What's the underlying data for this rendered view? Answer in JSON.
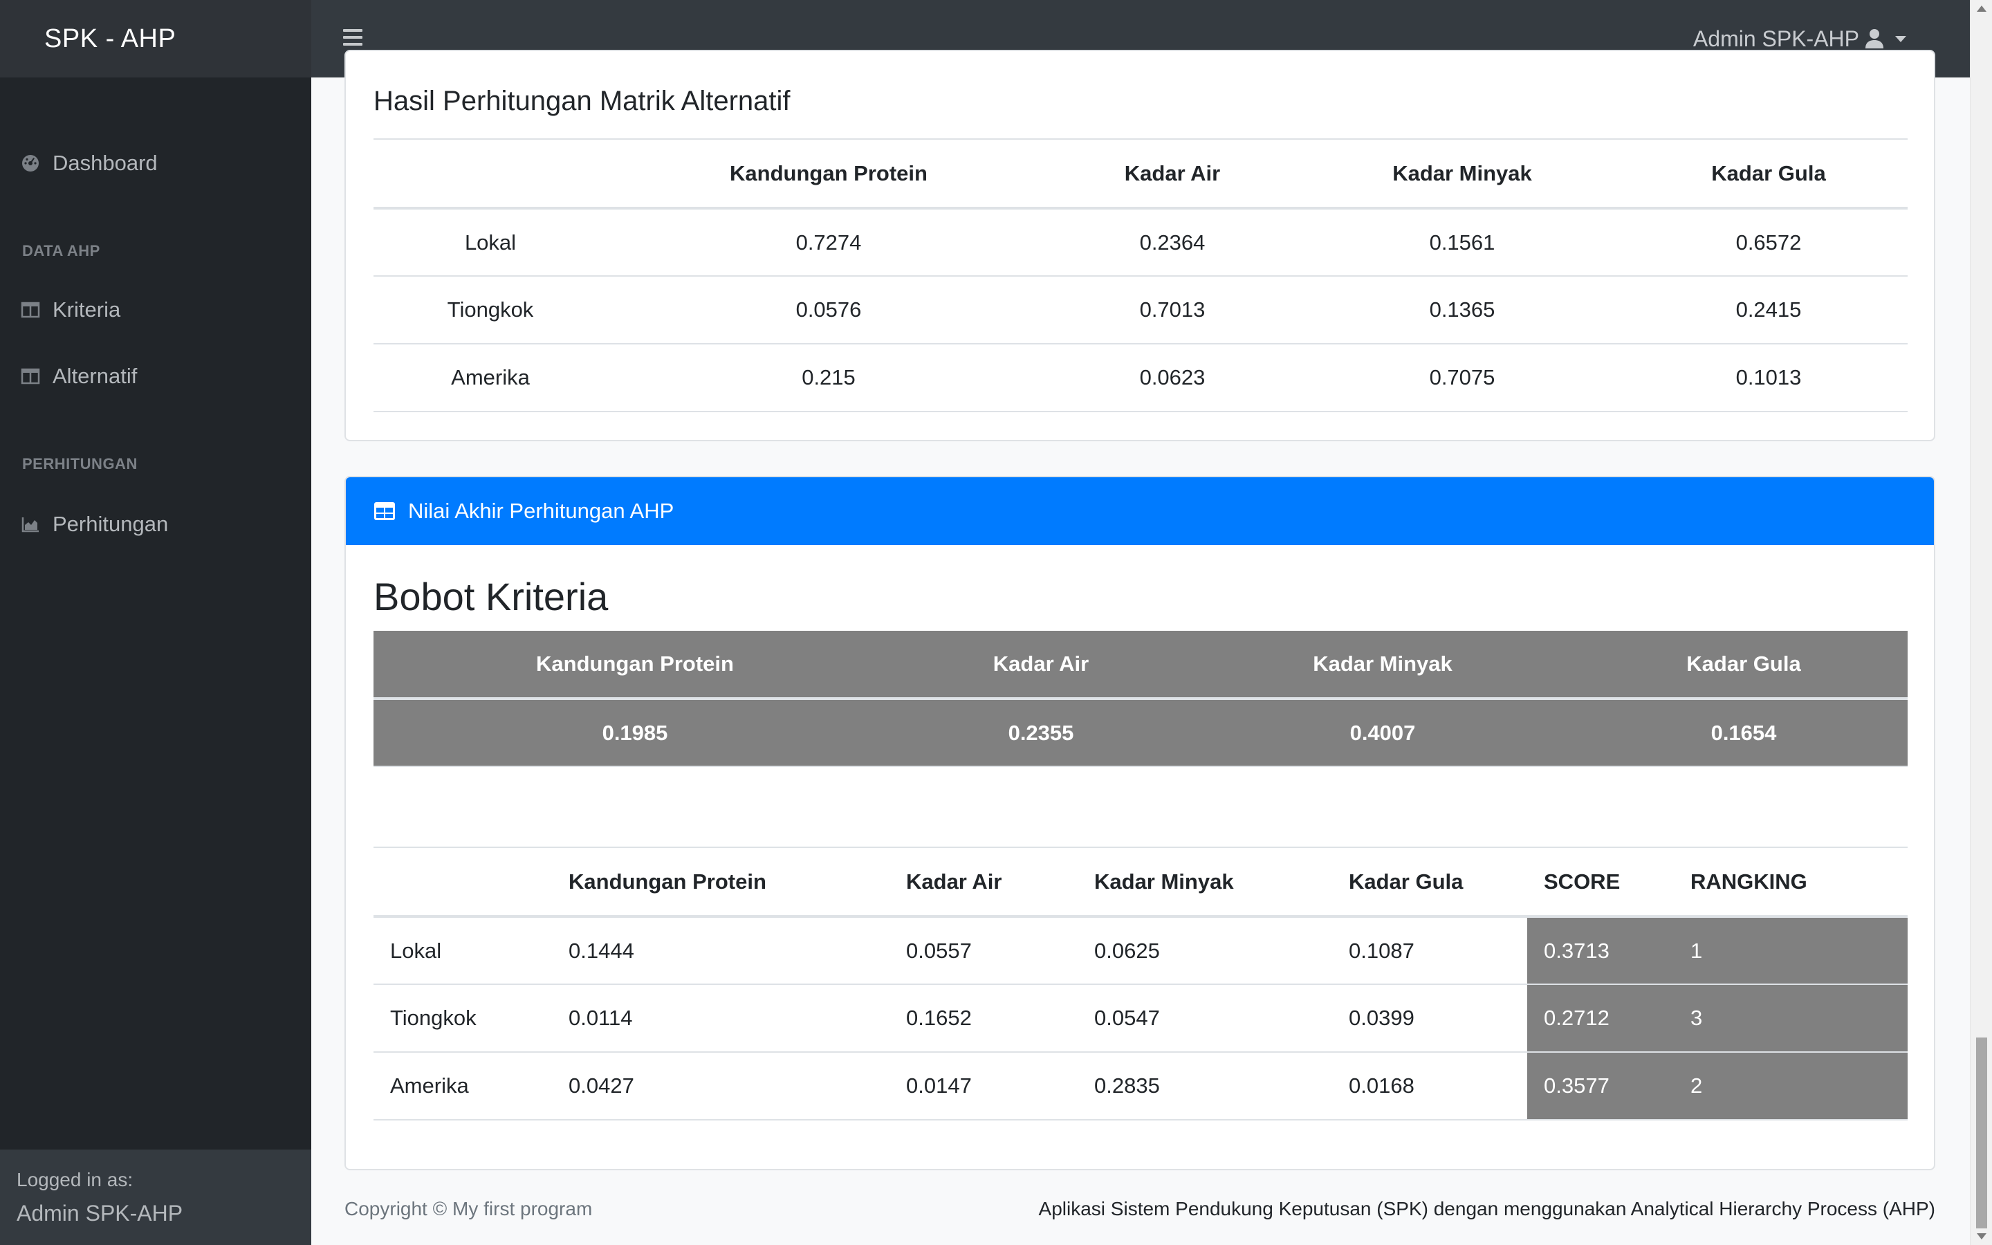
{
  "app": {
    "brand": "SPK - AHP"
  },
  "header": {
    "user_label": "Admin SPK-AHP"
  },
  "sidebar": {
    "dashboard": "Dashboard",
    "heading_data": "DATA AHP",
    "kriteria": "Kriteria",
    "alternatif": "Alternatif",
    "heading_perhitungan": "PERHITUNGAN",
    "perhitungan": "Perhitungan",
    "footer_small": "Logged in as:",
    "footer_name": "Admin SPK-AHP"
  },
  "matrix_card": {
    "title": "Hasil Perhitungan Matrik Alternatif",
    "headers": [
      "",
      "Kandungan Protein",
      "Kadar Air",
      "Kadar Minyak",
      "Kadar Gula"
    ],
    "rows": [
      [
        "Lokal",
        "0.7274",
        "0.2364",
        "0.1561",
        "0.6572"
      ],
      [
        "Tiongkok",
        "0.0576",
        "0.7013",
        "0.1365",
        "0.2415"
      ],
      [
        "Amerika",
        "0.215",
        "0.0623",
        "0.7075",
        "0.1013"
      ]
    ]
  },
  "result_card": {
    "header": "Nilai Akhir Perhitungan AHP",
    "bobot_title": "Bobot Kriteria",
    "bobot_headers": [
      "Kandungan Protein",
      "Kadar Air",
      "Kadar Minyak",
      "Kadar Gula"
    ],
    "bobot_values": [
      "0.1985",
      "0.2355",
      "0.4007",
      "0.1654"
    ],
    "final_headers": [
      "",
      "Kandungan Protein",
      "Kadar Air",
      "Kadar Minyak",
      "Kadar Gula",
      "SCORE",
      "RANGKING"
    ],
    "final_rows": [
      [
        "Lokal",
        "0.1444",
        "0.0557",
        "0.0625",
        "0.1087",
        "0.3713",
        "1"
      ],
      [
        "Tiongkok",
        "0.0114",
        "0.1652",
        "0.0547",
        "0.0399",
        "0.2712",
        "3"
      ],
      [
        "Amerika",
        "0.0427",
        "0.0147",
        "0.2835",
        "0.0168",
        "0.3577",
        "2"
      ]
    ]
  },
  "footer": {
    "left": "Copyright © My first program",
    "right": "Aplikasi Sistem Pendukung Keputusan (SPK) dengan menggunakan Analytical Hierarchy Process (AHP)"
  },
  "colors": {
    "primary": "#007bff",
    "navbar": "#343a40",
    "sidebar": "#212529",
    "highlight": "#808080"
  }
}
